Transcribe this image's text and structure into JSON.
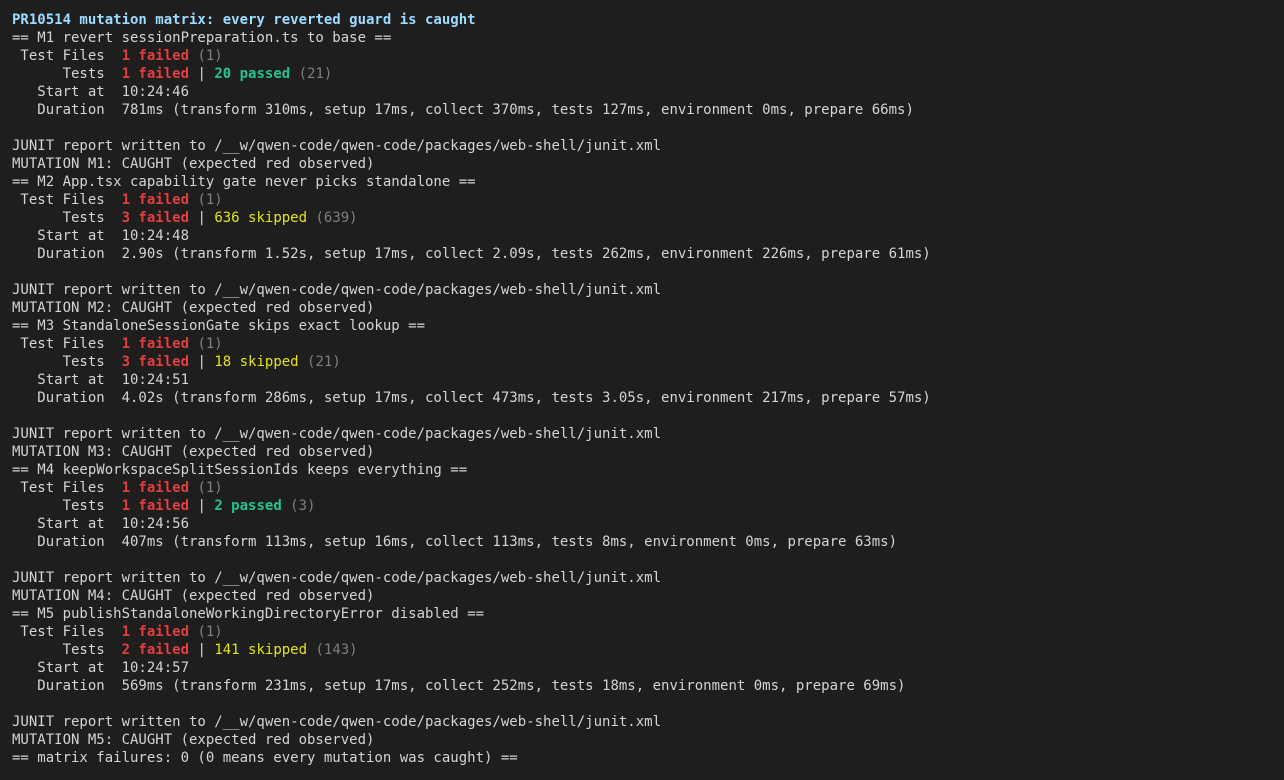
{
  "lines": [
    [
      {
        "t": "PR10514 mutation matrix: every reverted guard is caught",
        "c": "title",
        "b": true
      }
    ],
    [
      {
        "t": "== M1 revert sessionPreparation.ts to base =="
      }
    ],
    [
      {
        "t": " Test Files  "
      },
      {
        "t": "1 failed",
        "c": "red",
        "b": true
      },
      {
        "t": " (1)",
        "c": "dim"
      }
    ],
    [
      {
        "t": "      Tests  "
      },
      {
        "t": "1 failed",
        "c": "red",
        "b": true
      },
      {
        "t": " | "
      },
      {
        "t": "20 passed",
        "c": "green",
        "b": true
      },
      {
        "t": " (21)",
        "c": "dim"
      }
    ],
    [
      {
        "t": "   Start at  10:24:46"
      }
    ],
    [
      {
        "t": "   Duration  781ms (transform 310ms, setup 17ms, collect 370ms, tests 127ms, environment 0ms, prepare 66ms)"
      }
    ],
    [],
    [
      {
        "t": "JUNIT report written to /__w/qwen-code/qwen-code/packages/web-shell/junit.xml"
      }
    ],
    [
      {
        "t": "MUTATION M1: CAUGHT (expected red observed)"
      }
    ],
    [
      {
        "t": "== M2 App.tsx capability gate never picks standalone =="
      }
    ],
    [
      {
        "t": " Test Files  "
      },
      {
        "t": "1 failed",
        "c": "red",
        "b": true
      },
      {
        "t": " (1)",
        "c": "dim"
      }
    ],
    [
      {
        "t": "      Tests  "
      },
      {
        "t": "3 failed",
        "c": "red",
        "b": true
      },
      {
        "t": " | "
      },
      {
        "t": "636 skipped",
        "c": "yellow"
      },
      {
        "t": " (639)",
        "c": "dim"
      }
    ],
    [
      {
        "t": "   Start at  10:24:48"
      }
    ],
    [
      {
        "t": "   Duration  2.90s (transform 1.52s, setup 17ms, collect 2.09s, tests 262ms, environment 226ms, prepare 61ms)"
      }
    ],
    [],
    [
      {
        "t": "JUNIT report written to /__w/qwen-code/qwen-code/packages/web-shell/junit.xml"
      }
    ],
    [
      {
        "t": "MUTATION M2: CAUGHT (expected red observed)"
      }
    ],
    [
      {
        "t": "== M3 StandaloneSessionGate skips exact lookup =="
      }
    ],
    [
      {
        "t": " Test Files  "
      },
      {
        "t": "1 failed",
        "c": "red",
        "b": true
      },
      {
        "t": " (1)",
        "c": "dim"
      }
    ],
    [
      {
        "t": "      Tests  "
      },
      {
        "t": "3 failed",
        "c": "red",
        "b": true
      },
      {
        "t": " | "
      },
      {
        "t": "18 skipped",
        "c": "yellow"
      },
      {
        "t": " (21)",
        "c": "dim"
      }
    ],
    [
      {
        "t": "   Start at  10:24:51"
      }
    ],
    [
      {
        "t": "   Duration  4.02s (transform 286ms, setup 17ms, collect 473ms, tests 3.05s, environment 217ms, prepare 57ms)"
      }
    ],
    [],
    [
      {
        "t": "JUNIT report written to /__w/qwen-code/qwen-code/packages/web-shell/junit.xml"
      }
    ],
    [
      {
        "t": "MUTATION M3: CAUGHT (expected red observed)"
      }
    ],
    [
      {
        "t": "== M4 keepWorkspaceSplitSessionIds keeps everything =="
      }
    ],
    [
      {
        "t": " Test Files  "
      },
      {
        "t": "1 failed",
        "c": "red",
        "b": true
      },
      {
        "t": " (1)",
        "c": "dim"
      }
    ],
    [
      {
        "t": "      Tests  "
      },
      {
        "t": "1 failed",
        "c": "red",
        "b": true
      },
      {
        "t": " | "
      },
      {
        "t": "2 passed",
        "c": "green",
        "b": true
      },
      {
        "t": " (3)",
        "c": "dim"
      }
    ],
    [
      {
        "t": "   Start at  10:24:56"
      }
    ],
    [
      {
        "t": "   Duration  407ms (transform 113ms, setup 16ms, collect 113ms, tests 8ms, environment 0ms, prepare 63ms)"
      }
    ],
    [],
    [
      {
        "t": "JUNIT report written to /__w/qwen-code/qwen-code/packages/web-shell/junit.xml"
      }
    ],
    [
      {
        "t": "MUTATION M4: CAUGHT (expected red observed)"
      }
    ],
    [
      {
        "t": "== M5 publishStandaloneWorkingDirectoryError disabled =="
      }
    ],
    [
      {
        "t": " Test Files  "
      },
      {
        "t": "1 failed",
        "c": "red",
        "b": true
      },
      {
        "t": " (1)",
        "c": "dim"
      }
    ],
    [
      {
        "t": "      Tests  "
      },
      {
        "t": "2 failed",
        "c": "red",
        "b": true
      },
      {
        "t": " | "
      },
      {
        "t": "141 skipped",
        "c": "yellow"
      },
      {
        "t": " (143)",
        "c": "dim"
      }
    ],
    [
      {
        "t": "   Start at  10:24:57"
      }
    ],
    [
      {
        "t": "   Duration  569ms (transform 231ms, setup 17ms, collect 252ms, tests 18ms, environment 0ms, prepare 69ms)"
      }
    ],
    [],
    [
      {
        "t": "JUNIT report written to /__w/qwen-code/qwen-code/packages/web-shell/junit.xml"
      }
    ],
    [
      {
        "t": "MUTATION M5: CAUGHT (expected red observed)"
      }
    ],
    [
      {
        "t": "== matrix failures: 0 (0 means every mutation was caught) =="
      }
    ]
  ],
  "colors": {
    "background": "#1e1e1e",
    "default": "#d4d4d4",
    "title": "#9cdcfe",
    "red": "#e53d3d",
    "green": "#23c58b",
    "yellow": "#e5e510",
    "dim": "#7f7f7f"
  }
}
